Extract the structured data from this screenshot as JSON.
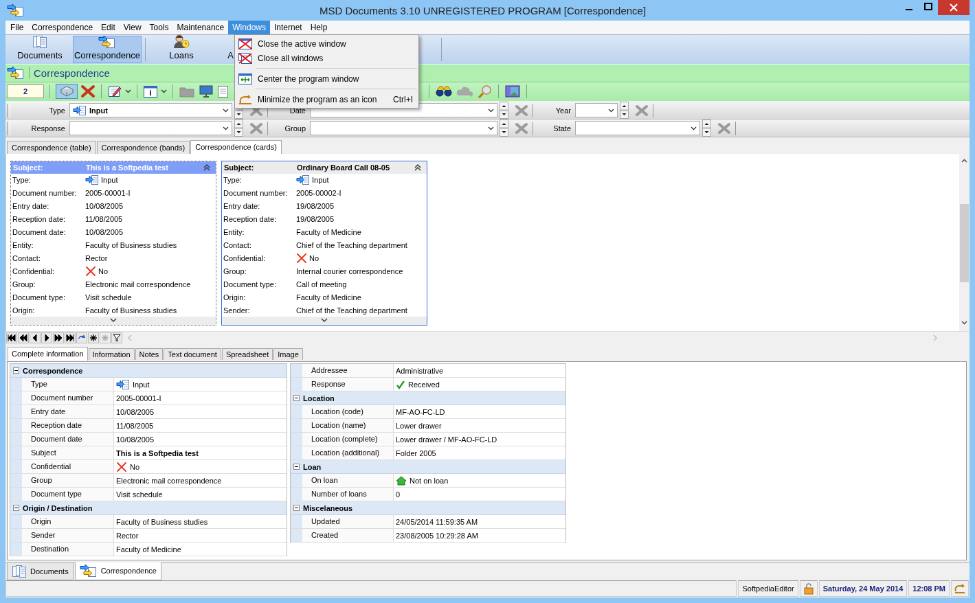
{
  "window": {
    "title": "MSD Documents 3.10 UNREGISTERED PROGRAM [Correspondence]"
  },
  "menu_bar": [
    {
      "label": "File",
      "selected": false
    },
    {
      "label": "Correspondence",
      "selected": false
    },
    {
      "label": "Edit",
      "selected": false
    },
    {
      "label": "View",
      "selected": false
    },
    {
      "label": "Tools",
      "selected": false
    },
    {
      "label": "Maintenance",
      "selected": false
    },
    {
      "label": "Windows",
      "selected": true
    },
    {
      "label": "Internet",
      "selected": false
    },
    {
      "label": "Help",
      "selected": false
    }
  ],
  "windows_menu": [
    {
      "label": "Close the active window",
      "kind": "close-window",
      "separator_after": false
    },
    {
      "label": "Close all windows",
      "kind": "close-all",
      "separator_after": true
    },
    {
      "label": "Center the program window",
      "kind": "center",
      "separator_after": true
    },
    {
      "label": "Minimize the program as an icon",
      "kind": "minimize",
      "shortcut": "Ctrl+I",
      "separator_after": false
    }
  ],
  "main_toolbar": [
    {
      "label": "Documents",
      "kind": "documents",
      "selected": false
    },
    {
      "label": "Correspondence",
      "kind": "correspondence",
      "selected": true
    },
    {
      "label": "Loans",
      "kind": "loans",
      "selected": false
    },
    {
      "label": "A",
      "kind": "partial",
      "selected": false
    }
  ],
  "module_header": {
    "title": "Correspondence"
  },
  "record_count": "2",
  "filter_rows": [
    {
      "filters": [
        {
          "label": "Type",
          "value": "Input"
        },
        {
          "label": "Date"
        },
        {
          "label": "Year"
        }
      ]
    },
    {
      "filters": [
        {
          "label": "Response"
        },
        {
          "label": "Group"
        },
        {
          "label": "State"
        }
      ]
    }
  ],
  "view_tabs": [
    {
      "label": "Correspondence (table)",
      "selected": false
    },
    {
      "label": "Correspondence (bands)",
      "selected": false
    },
    {
      "label": "Correspondence (cards)",
      "selected": true
    }
  ],
  "cards": [
    {
      "selected": true,
      "subject_label": "Subject:",
      "subject": "This is a Softpedia test",
      "fields": [
        {
          "label": "Type:",
          "value": "Input",
          "kind": "type"
        },
        {
          "label": "Document number:",
          "value": "2005-00001-I",
          "kind": "text"
        },
        {
          "label": "Entry date:",
          "value": "10/08/2005",
          "kind": "text"
        },
        {
          "label": "Reception date:",
          "value": "11/08/2005",
          "kind": "text"
        },
        {
          "label": "Document date:",
          "value": "10/08/2005",
          "kind": "text"
        },
        {
          "label": "Entity:",
          "value": "Faculty of Business studies",
          "kind": "text"
        },
        {
          "label": "Contact:",
          "value": "Rector",
          "kind": "text"
        },
        {
          "label": "Confidential:",
          "value": "No",
          "kind": "no"
        },
        {
          "label": "Group:",
          "value": "Electronic mail correspondence",
          "kind": "text"
        },
        {
          "label": "Document type:",
          "value": "Visit schedule",
          "kind": "text"
        },
        {
          "label": "Origin:",
          "value": "Faculty of Business studies",
          "kind": "text"
        }
      ]
    },
    {
      "selected": false,
      "subject_label": "Subject:",
      "subject": "Ordinary Board Call 08-05",
      "fields": [
        {
          "label": "Type:",
          "value": "Input",
          "kind": "type"
        },
        {
          "label": "Document number:",
          "value": "2005-00002-I",
          "kind": "text"
        },
        {
          "label": "Entry date:",
          "value": "19/08/2005",
          "kind": "text"
        },
        {
          "label": "Reception date:",
          "value": "19/08/2005",
          "kind": "text"
        },
        {
          "label": "Entity:",
          "value": "Faculty of Medicine",
          "kind": "text"
        },
        {
          "label": "Contact:",
          "value": "Chief of the Teaching department",
          "kind": "text"
        },
        {
          "label": "Confidential:",
          "value": "No",
          "kind": "no"
        },
        {
          "label": "Group:",
          "value": "Internal courier correspondence",
          "kind": "text"
        },
        {
          "label": "Document type:",
          "value": "Call of meeting",
          "kind": "text"
        },
        {
          "label": "Origin:",
          "value": "Faculty of Medicine",
          "kind": "text"
        },
        {
          "label": "Sender:",
          "value": "Chief of the Teaching department",
          "kind": "text"
        }
      ]
    }
  ],
  "detail_tabs": [
    {
      "label": "Complete information",
      "selected": true
    },
    {
      "label": "Information",
      "selected": false
    },
    {
      "label": "Notes",
      "selected": false
    },
    {
      "label": "Text document",
      "selected": false
    },
    {
      "label": "Spreadsheet",
      "selected": false
    },
    {
      "label": "Image",
      "selected": false
    }
  ],
  "details": {
    "left": [
      {
        "title": "Correspondence",
        "expanded": true,
        "rows": [
          {
            "label": "Type",
            "value": "Input",
            "kind": "type"
          },
          {
            "label": "Document number",
            "value": "2005-00001-I",
            "kind": "text"
          },
          {
            "label": "Entry date",
            "value": "10/08/2005",
            "kind": "text"
          },
          {
            "label": "Reception date",
            "value": "11/08/2005",
            "kind": "text"
          },
          {
            "label": "Document date",
            "value": "10/08/2005",
            "kind": "text"
          },
          {
            "label": "Subject",
            "value": "This is a Softpedia test",
            "kind": "bold"
          },
          {
            "label": "Confidential",
            "value": "No",
            "kind": "no"
          },
          {
            "label": "Group",
            "value": "Electronic mail correspondence",
            "kind": "text"
          },
          {
            "label": "Document type",
            "value": "Visit schedule",
            "kind": "text"
          }
        ]
      },
      {
        "title": "Origin / Destination",
        "expanded": true,
        "rows": [
          {
            "label": "Origin",
            "value": "Faculty of Business studies",
            "kind": "text"
          },
          {
            "label": "Sender",
            "value": "Rector",
            "kind": "text"
          },
          {
            "label": "Destination",
            "value": "Faculty of Medicine",
            "kind": "text"
          }
        ]
      }
    ],
    "right": [
      {
        "rows": [
          {
            "label": "Addressee",
            "value": "Administrative",
            "kind": "text"
          },
          {
            "label": "Response",
            "value": "Received",
            "kind": "check"
          }
        ]
      },
      {
        "title": "Location",
        "expanded": true,
        "rows": [
          {
            "label": "Location (code)",
            "value": "MF-AO-FC-LD",
            "kind": "text"
          },
          {
            "label": "Location (name)",
            "value": "Lower drawer",
            "kind": "text"
          },
          {
            "label": "Location (complete)",
            "value": "Lower drawer / MF-AO-FC-LD",
            "kind": "text"
          },
          {
            "label": "Location (additional)",
            "value": "Folder 2005",
            "kind": "text"
          }
        ]
      },
      {
        "title": "Loan",
        "expanded": true,
        "rows": [
          {
            "label": "On loan",
            "value": "Not on loan",
            "kind": "home"
          },
          {
            "label": "Number of loans",
            "value": "0",
            "kind": "text"
          }
        ]
      },
      {
        "title": "Miscelaneous",
        "expanded": true,
        "rows": [
          {
            "label": "Updated",
            "value": "24/05/2014 11:59:35 AM",
            "kind": "text"
          },
          {
            "label": "Created",
            "value": "23/08/2005 10:29:28 AM",
            "kind": "text"
          }
        ]
      }
    ]
  },
  "document_tabs": [
    {
      "label": "Documents",
      "kind": "documents",
      "selected": false
    },
    {
      "label": "Correspondence",
      "kind": "correspondence",
      "selected": true
    }
  ],
  "status_bar": {
    "user": "SoftpediaEditor",
    "date": "Saturday, 24 May 2014",
    "time": "12:08 PM"
  }
}
